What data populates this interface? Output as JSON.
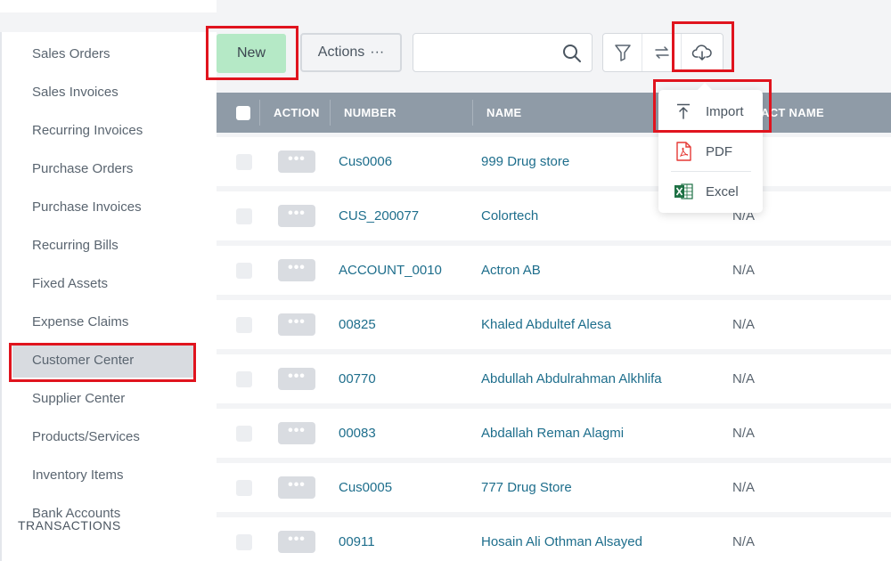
{
  "sidebar": {
    "items": [
      {
        "label": "Sales Orders"
      },
      {
        "label": "Sales Invoices"
      },
      {
        "label": "Recurring Invoices"
      },
      {
        "label": "Purchase Orders"
      },
      {
        "label": "Purchase Invoices"
      },
      {
        "label": "Recurring Bills"
      },
      {
        "label": "Fixed Assets"
      },
      {
        "label": "Expense Claims"
      },
      {
        "label": "Customer Center"
      },
      {
        "label": "Supplier Center"
      },
      {
        "label": "Products/Services"
      },
      {
        "label": "Inventory Items"
      },
      {
        "label": "Bank Accounts"
      }
    ],
    "active_item": "Customer Center",
    "section_heading": "TRANSACTIONS"
  },
  "toolbar": {
    "new_label": "New",
    "actions_label": "Actions",
    "actions_dots": "···",
    "search": {
      "value": "",
      "placeholder": ""
    },
    "icons": [
      "filter-icon",
      "refresh-icon",
      "cloud-download-icon"
    ]
  },
  "table": {
    "columns": [
      "ACTION",
      "NUMBER",
      "NAME",
      "ACT NAME"
    ],
    "action_dots": "•••",
    "rows": [
      {
        "number": "Cus0006",
        "name": "999 Drug store",
        "contact": ""
      },
      {
        "number": "CUS_200077",
        "name": "Colortech",
        "contact": "N/A"
      },
      {
        "number": "ACCOUNT_0010",
        "name": "Actron AB",
        "contact": "N/A"
      },
      {
        "number": "00825",
        "name": "Khaled Abdultef Alesa",
        "contact": "N/A"
      },
      {
        "number": "00770",
        "name": "Abdullah Abdulrahman Alkhlifa",
        "contact": "N/A"
      },
      {
        "number": "00083",
        "name": "Abdallah Reman Alagmi",
        "contact": "N/A"
      },
      {
        "number": "Cus0005",
        "name": "777 Drug Store",
        "contact": "N/A"
      },
      {
        "number": "00911",
        "name": "Hosain Ali Othman Alsayed",
        "contact": "N/A"
      }
    ]
  },
  "export_menu": {
    "items": [
      {
        "label": "Import",
        "icon": "upload-icon"
      },
      {
        "label": "PDF",
        "icon": "pdf-icon"
      },
      {
        "label": "Excel",
        "icon": "excel-icon"
      }
    ]
  },
  "colors": {
    "new_button": "#b5e9c6",
    "table_header": "#8f9ba7",
    "link": "#1e6e8c",
    "highlight": "#e0141e",
    "pdf": "#e53935",
    "excel": "#1e7145"
  }
}
